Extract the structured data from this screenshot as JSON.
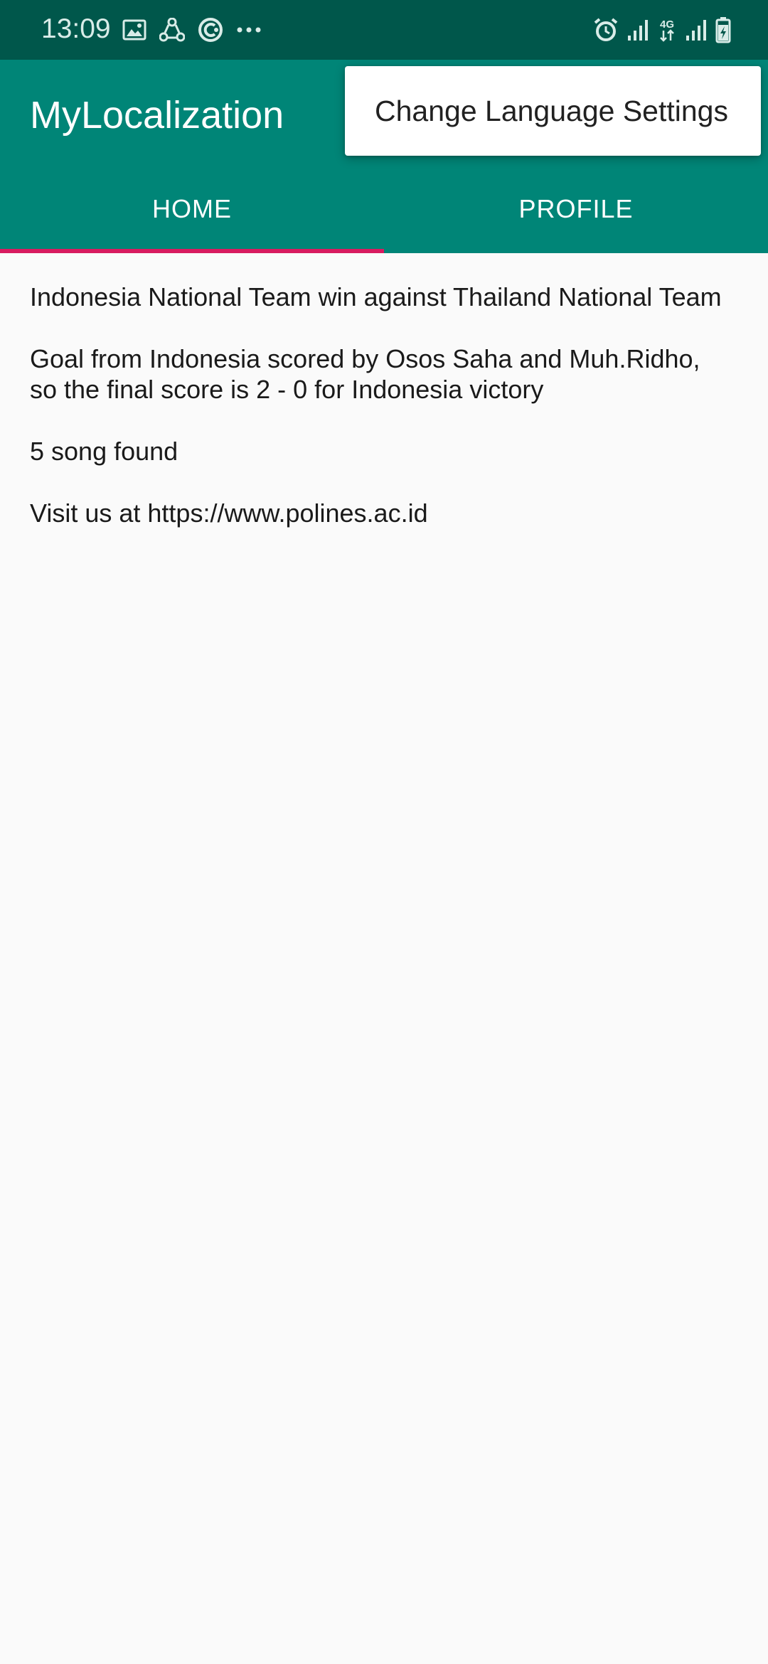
{
  "status_bar": {
    "time": "13:09",
    "left_icons": [
      "image-icon",
      "share-icon",
      "sync-icon",
      "more-dots-icon"
    ],
    "right_icons": [
      "alarm-icon",
      "signal-icon",
      "network-4g-icon",
      "signal-icon",
      "battery-charging-icon"
    ],
    "network_label": "4G",
    "more_label": "···"
  },
  "app_bar": {
    "title": "MyLocalization"
  },
  "overflow_menu": {
    "items": [
      {
        "label": "Change Language Settings"
      }
    ]
  },
  "tabs": [
    {
      "label": "HOME",
      "selected": true
    },
    {
      "label": "PROFILE",
      "selected": false
    }
  ],
  "colors": {
    "status_bar": "#00574b",
    "primary": "#008577",
    "accent": "#d81b60",
    "background": "#fafafa"
  },
  "content": {
    "news_title": "Indonesia National Team win against Thailand National Team",
    "news_body": "Goal from Indonesia scored by Osos Saha and Muh.Ridho, so the final score is 2 - 0 for Indonesia victory",
    "song_count": "5 song found",
    "visit_text": "Visit us at https://www.polines.ac.id"
  }
}
